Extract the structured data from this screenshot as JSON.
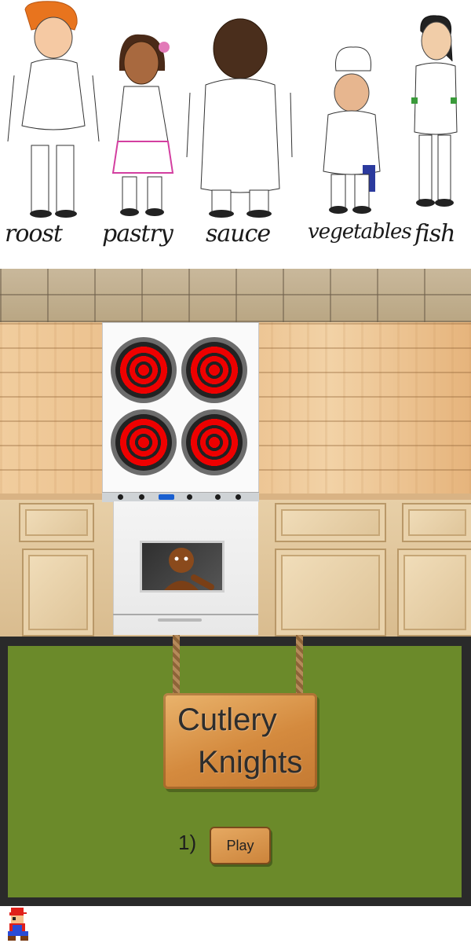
{
  "chefs": {
    "labels": [
      "roost",
      "pastry",
      "sauce",
      "vegetables",
      "fish"
    ]
  },
  "menu": {
    "title_line1": "Cutlery",
    "title_line2": "Knights",
    "level_number": "1)",
    "play_label": "Play"
  },
  "colors": {
    "board_green": "#6b8a2a",
    "burner_red": "#e00000",
    "stove_display": "#1a5fd0"
  },
  "icons": {
    "character_sprite": "pixel-chef-sprite-icon"
  }
}
